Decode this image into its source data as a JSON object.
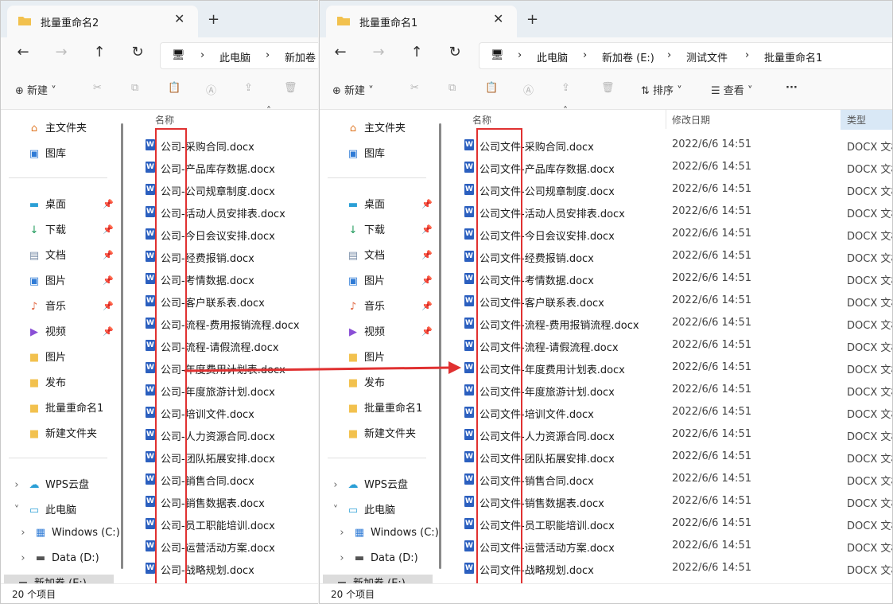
{
  "left_window": {
    "tab_title": "批量重命名2",
    "breadcrumbs": [
      "此电脑",
      "新加卷"
    ],
    "toolbar": {
      "new_label": "新建"
    },
    "sidebar": {
      "quick": [
        {
          "label": "主文件夹",
          "icon": "home-icon"
        },
        {
          "label": "图库",
          "icon": "gallery-icon"
        }
      ],
      "pinned": [
        {
          "label": "桌面",
          "icon": "desktop-icon",
          "pinned": true
        },
        {
          "label": "下载",
          "icon": "download-icon",
          "pinned": true
        },
        {
          "label": "文档",
          "icon": "document-icon",
          "pinned": true
        },
        {
          "label": "图片",
          "icon": "pictures-icon",
          "pinned": true
        },
        {
          "label": "音乐",
          "icon": "music-icon",
          "pinned": true
        },
        {
          "label": "视频",
          "icon": "video-icon",
          "pinned": true
        },
        {
          "label": "图片",
          "icon": "folder-icon",
          "pinned": false
        },
        {
          "label": "发布",
          "icon": "folder-icon",
          "pinned": false
        },
        {
          "label": "批量重命名1",
          "icon": "folder-icon",
          "pinned": false
        },
        {
          "label": "新建文件夹",
          "icon": "folder-icon",
          "pinned": false
        }
      ],
      "tree": [
        {
          "label": "WPS云盘",
          "icon": "cloud-icon"
        },
        {
          "label": "此电脑",
          "icon": "pc-icon"
        },
        {
          "label": "Windows (C:)",
          "icon": "drive-icon"
        },
        {
          "label": "Data (D:)",
          "icon": "drive-icon"
        },
        {
          "label": "新加卷 (E:)",
          "icon": "drive-icon"
        }
      ]
    },
    "column_name": "名称",
    "files": [
      "公司-采购合同.docx",
      "公司-产品库存数据.docx",
      "公司-公司规章制度.docx",
      "公司-活动人员安排表.docx",
      "公司-今日会议安排.docx",
      "公司-经费报销.docx",
      "公司-考情数据.docx",
      "公司-客户联系表.docx",
      "公司-流程-费用报销流程.docx",
      "公司-流程-请假流程.docx",
      "公司-年度费用计划表.docx",
      "公司-年度旅游计划.docx",
      "公司-培训文件.docx",
      "公司-人力资源合同.docx",
      "公司-团队拓展安排.docx",
      "公司-销售合同.docx",
      "公司-销售数据表.docx",
      "公司-员工职能培训.docx",
      "公司-运营活动方案.docx",
      "公司-战略规划.docx"
    ],
    "status": "20 个项目"
  },
  "right_window": {
    "tab_title": "批量重命名1",
    "breadcrumbs": [
      "此电脑",
      "新加卷 (E:)",
      "测试文件",
      "批量重命名1"
    ],
    "toolbar": {
      "new_label": "新建",
      "sort_label": "排序",
      "view_label": "查看",
      "more_label": "···"
    },
    "columns": {
      "name": "名称",
      "date": "修改日期",
      "type": "类型"
    },
    "file_date": "2022/6/6 14:51",
    "file_type": "DOCX 文档",
    "files": [
      "公司文件-采购合同.docx",
      "公司文件-产品库存数据.docx",
      "公司文件-公司规章制度.docx",
      "公司文件-活动人员安排表.docx",
      "公司文件-今日会议安排.docx",
      "公司文件-经费报销.docx",
      "公司文件-考情数据.docx",
      "公司文件-客户联系表.docx",
      "公司文件-流程-费用报销流程.docx",
      "公司文件-流程-请假流程.docx",
      "公司文件-年度费用计划表.docx",
      "公司文件-年度旅游计划.docx",
      "公司文件-培训文件.docx",
      "公司文件-人力资源合同.docx",
      "公司文件-团队拓展安排.docx",
      "公司文件-销售合同.docx",
      "公司文件-销售数据表.docx",
      "公司文件-员工职能培训.docx",
      "公司文件-运营活动方案.docx",
      "公司文件-战略规划.docx"
    ],
    "status": "20 个项目"
  },
  "colors": {
    "highlight": "#e03131",
    "word_blue": "#2b5fbf",
    "folder": "#f2c14e"
  }
}
